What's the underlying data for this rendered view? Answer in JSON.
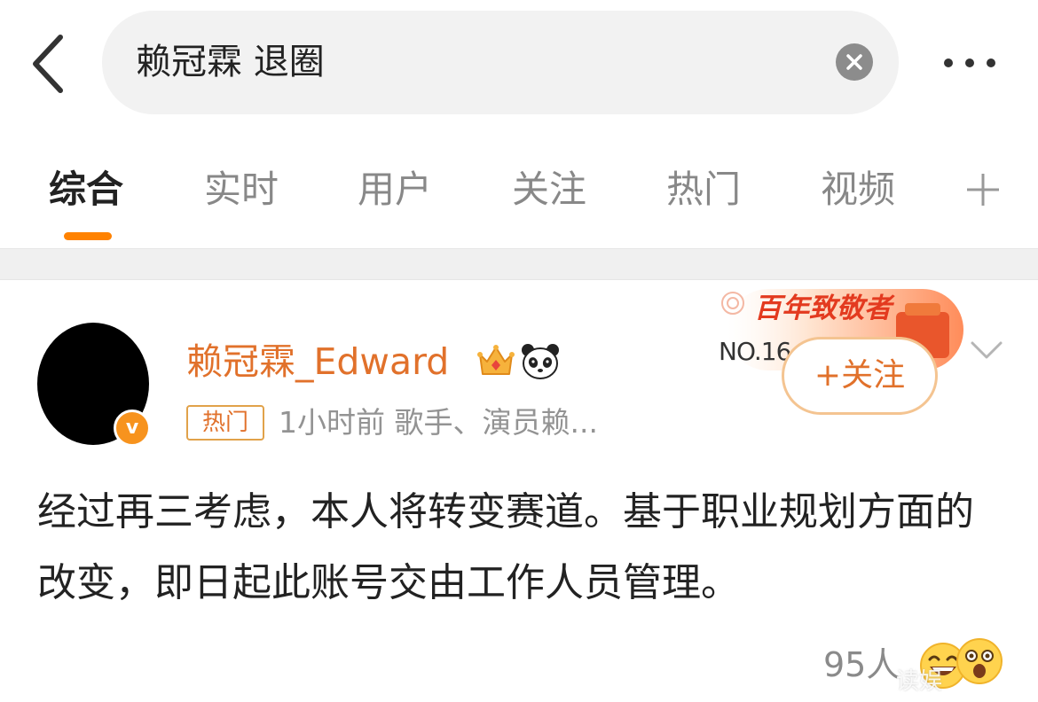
{
  "search": {
    "query": "赖冠霖 退圈",
    "back_icon": "chevron-left-icon",
    "clear_icon": "close-icon",
    "more_icon": "more-dots-icon"
  },
  "tabs": [
    {
      "label": "综合",
      "active": true
    },
    {
      "label": "实时",
      "active": false
    },
    {
      "label": "用户",
      "active": false
    },
    {
      "label": "关注",
      "active": false
    },
    {
      "label": "热门",
      "active": false
    },
    {
      "label": "视频",
      "active": false
    }
  ],
  "tab_add_icon": "plus-icon",
  "accent_color": "#ff8200",
  "post": {
    "author": "赖冠霖_Edward",
    "verified_mark": "v",
    "badges": [
      "crown-icon",
      "panda-icon"
    ],
    "tag": "热门",
    "meta": "1小时前  歌手、演员赖...",
    "centennial_title": "百年致敬者",
    "centennial_no": "NO.16",
    "follow_label": "+关注",
    "text": "经过再三考虑，本人将转变赛道。基于职业规划方面的改变，即日起此账号交由工作人员管理。",
    "reactions_count": "95人",
    "reaction_icons": [
      "laugh-icon",
      "surprised-icon"
    ],
    "watermark": "读娱"
  }
}
